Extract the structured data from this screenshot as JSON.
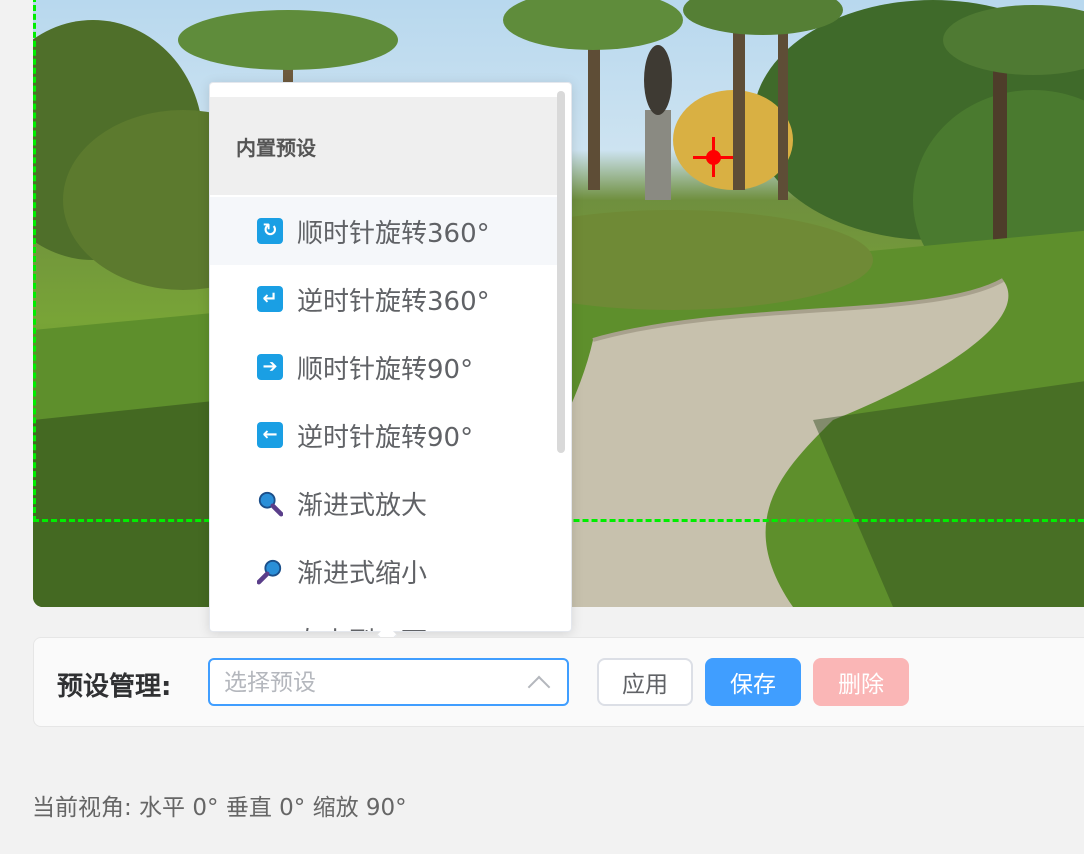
{
  "viewer": {
    "crosshair_icon": "crosshair-icon"
  },
  "dropdown": {
    "group_title": "内置预设",
    "items": [
      {
        "label": "顺时针旋转360°",
        "icon": "rotate-cw-icon",
        "color": "#1a9fe4"
      },
      {
        "label": "逆时针旋转360°",
        "icon": "rotate-ccw-icon",
        "color": "#1a9fe4"
      },
      {
        "label": "顺时针旋转90°",
        "icon": "arrow-right-icon",
        "color": "#1a9fe4"
      },
      {
        "label": "逆时针旋转90°",
        "icon": "arrow-left-icon",
        "color": "#1a9fe4"
      },
      {
        "label": "渐进式放大",
        "icon": "magnifier-zoom-in-icon",
        "color": "#1a9fe4"
      },
      {
        "label": "渐进式缩小",
        "icon": "magnifier-zoom-out-icon",
        "color": "#1a9fe4"
      },
      {
        "label": "左上到右下",
        "icon": "arrow-diagonal-icon",
        "color": "#1a9fe4"
      }
    ]
  },
  "preset_bar": {
    "label": "预设管理:",
    "select_placeholder": "选择预设",
    "select_value": "",
    "apply_label": "应用",
    "save_label": "保存",
    "delete_label": "删除",
    "primary_color": "#409eff",
    "danger_disabled_color": "#fab6b6"
  },
  "status": {
    "text": "当前视角: 水平 0° 垂直 0° 缩放 90°"
  }
}
